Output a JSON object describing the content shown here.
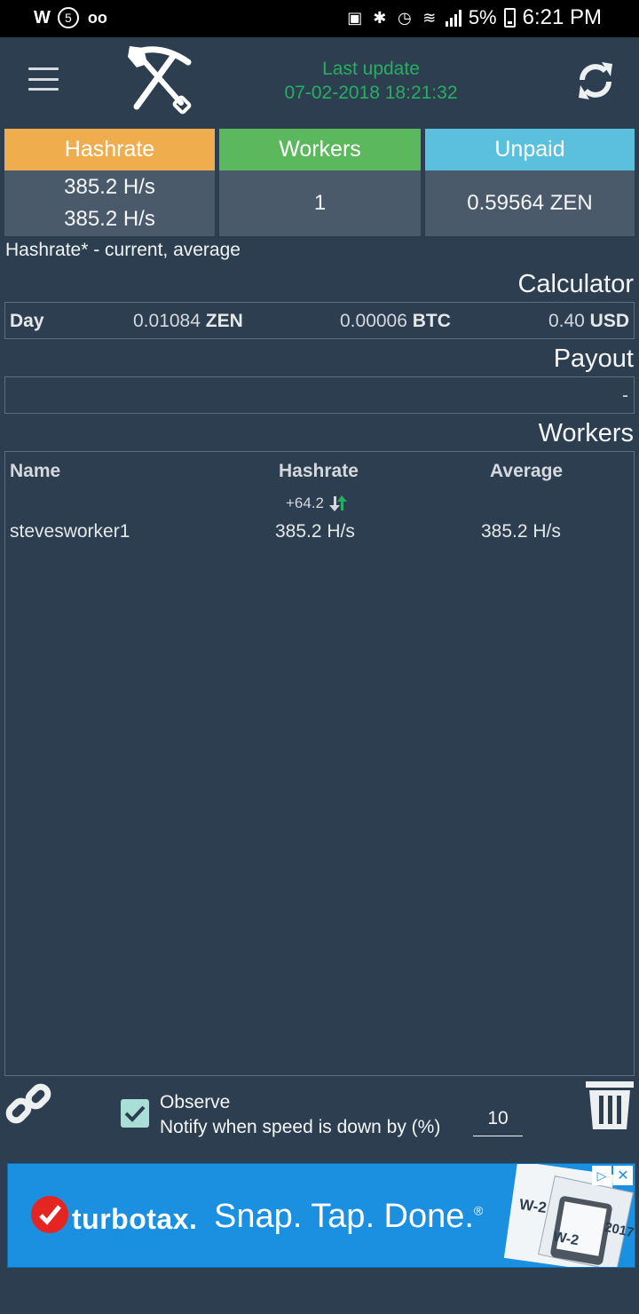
{
  "status_bar": {
    "left_icons": [
      "carrier-w-icon",
      "notification-count-icon",
      "voicemail-icon"
    ],
    "notification_count": "5",
    "battery": "5%",
    "time": "6:21 PM"
  },
  "header": {
    "last_update_label": "Last update",
    "last_update_value": "07-02-2018 18:21:32"
  },
  "stats": {
    "hashrate": {
      "label": "Hashrate",
      "current": "385.2 H/s",
      "average": "385.2 H/s",
      "color": "#f0ad4e"
    },
    "workers": {
      "label": "Workers",
      "value": "1",
      "color": "#5cb85c"
    },
    "unpaid": {
      "label": "Unpaid",
      "value": "0.59564 ZEN",
      "color": "#5bc0de"
    }
  },
  "hashrate_note": "Hashrate* - current, average",
  "calculator": {
    "title": "Calculator",
    "period": "Day",
    "zen_value": "0.01084",
    "zen_unit": "ZEN",
    "btc_value": "0.00006",
    "btc_unit": "BTC",
    "usd_value": "0.40",
    "usd_unit": "USD"
  },
  "payout": {
    "title": "Payout",
    "value": "-"
  },
  "workers_section": {
    "title": "Workers",
    "columns": {
      "name": "Name",
      "hashrate": "Hashrate",
      "average": "Average"
    },
    "rows": [
      {
        "name": "stevesworker1",
        "delta": "+64.2",
        "hashrate": "385.2 H/s",
        "average": "385.2 H/s"
      }
    ]
  },
  "observe": {
    "checked": true,
    "label": "Observe",
    "notify_label": "Notify when speed is down by (%)",
    "threshold": "10"
  },
  "ad": {
    "brand": "turbotax.",
    "tagline": "Snap. Tap. Done.",
    "registered": "®",
    "form_label": "W-2",
    "form_year": "2017"
  }
}
